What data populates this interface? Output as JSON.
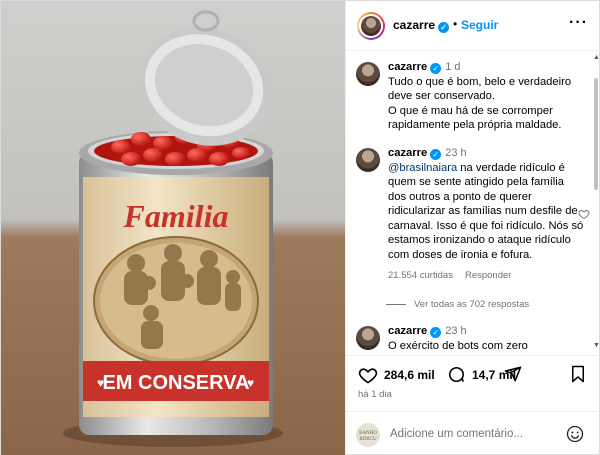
{
  "header": {
    "username": "cazarre",
    "separator": "•",
    "follow_label": "Seguir",
    "more_label": "···"
  },
  "image": {
    "can_title": "Familia",
    "can_banner": "EM CONSERVA",
    "banner_hearts": "♥"
  },
  "comments": [
    {
      "username": "cazarre",
      "time": "1 d",
      "text_line1": "Tudo o que é bom, belo e verdadeiro deve ser conservado.",
      "text_line2": "O que é mau há de se corromper rapidamente pela própria maldade."
    },
    {
      "username": "cazarre",
      "time": "23 h",
      "mention": "@brasilnaiara",
      "text": " na verdade ridículo é quem se sente atingido pela família dos outros a ponto de querer ridicularizar as famílias num desfile de carnaval. Isso é que foi ridículo. Nós só estamos ironizando o ataque ridículo com doses de ironia e fofura.",
      "likes": "21.554 curtidas",
      "reply_label": "Responder"
    },
    {
      "username": "cazarre",
      "time": "23 h",
      "text": "O exército de bots com zero"
    }
  ],
  "view_all_label": "Ver todas as 702 respostas",
  "actions": {
    "likes_count": "284,6 mil",
    "comments_count": "14,7 mil"
  },
  "post_date": "há 1 dia",
  "add_comment": {
    "placeholder": "Adicione um comentário...",
    "avatar_text": "BANHO RIDICU"
  },
  "colors": {
    "link_blue": "#0095f6",
    "mention_blue": "#00376b",
    "muted": "#737373",
    "can_red": "#c8322b"
  }
}
